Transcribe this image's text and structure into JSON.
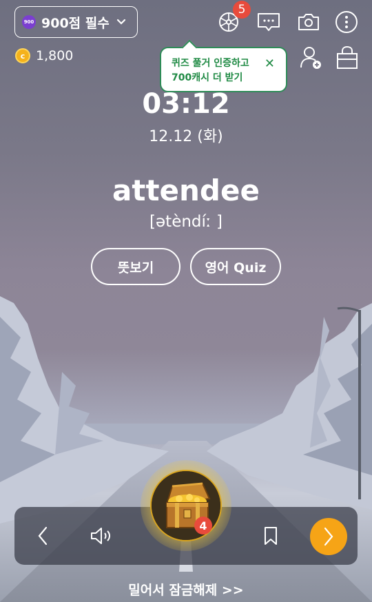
{
  "header": {
    "deck_badge": "900",
    "deck_label": "900점 필수",
    "coins": "1,800",
    "notification_count": "5"
  },
  "tooltip": {
    "line1": "퀴즈 풀거 인증하고",
    "line2": "700캐시 더 받기",
    "close": "✕"
  },
  "main": {
    "time": "03:12",
    "date": "12.12 (화)",
    "word": "attendee",
    "phonetic": "[ətèndíː ]",
    "meaning_button": "뜻보기",
    "quiz_button": "영어 Quiz"
  },
  "bottom": {
    "chest_count": "4",
    "unlock_label": "밀어서 잠금해제 >>"
  },
  "colors": {
    "accent_orange": "#f6a416",
    "badge_red": "#e84b3c",
    "tooltip_green": "#1f8a44",
    "deck_purple": "#7b3fd0"
  }
}
